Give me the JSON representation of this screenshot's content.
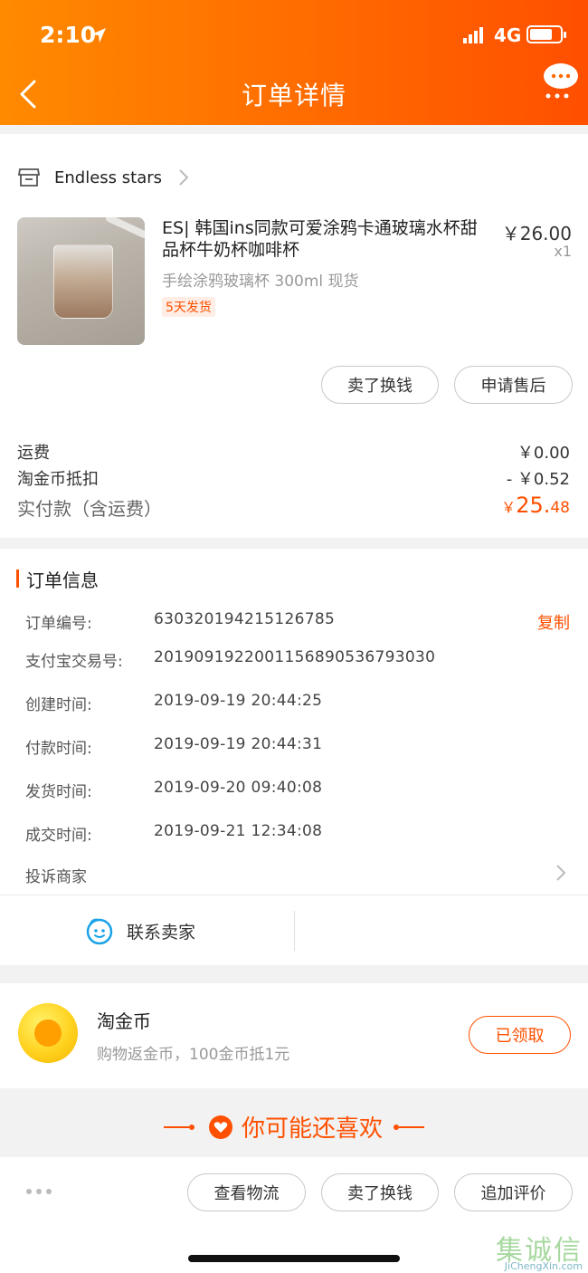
{
  "status_bar": {
    "time": "2:10",
    "network": "4G"
  },
  "header": {
    "title": "订单详情"
  },
  "store": {
    "name": "Endless stars"
  },
  "product": {
    "title": "ES| 韩国ins同款可爱涂鸦卡通玻璃水杯甜品杯牛奶杯咖啡杯",
    "price": "￥26.00",
    "quantity": "x1",
    "spec": "手绘涂鸦玻璃杯 300ml 现货",
    "ship_badge": "5天发货",
    "btn_sell": "卖了换钱",
    "btn_aftersale": "申请售后"
  },
  "fees": {
    "shipping_label": "运费",
    "shipping_value": "￥0.00",
    "coin_deduct_label": "淘金币抵扣",
    "coin_deduct_value": "- ￥0.52",
    "paid_label": "实付款（含运费）",
    "paid_currency": "￥",
    "paid_int": "25.",
    "paid_dec": "48"
  },
  "order_info": {
    "title": "订单信息",
    "copy": "复制",
    "rows": [
      {
        "label": "订单编号:",
        "value": "630320194215126785"
      },
      {
        "label": "支付宝交易号:",
        "value": "2019091922001156890536793030"
      },
      {
        "label": "创建时间:",
        "value": "2019-09-19 20:44:25"
      },
      {
        "label": "付款时间:",
        "value": "2019-09-19 20:44:31"
      },
      {
        "label": "发货时间:",
        "value": "2019-09-20 09:40:08"
      },
      {
        "label": "成交时间:",
        "value": "2019-09-21 12:34:08"
      }
    ],
    "complain": "投诉商家",
    "contact": "联系卖家"
  },
  "coin": {
    "title": "淘金币",
    "subtitle": "购物返金币，100金币抵1元",
    "button": "已领取"
  },
  "recommend": {
    "title": "你可能还喜欢"
  },
  "bottom_bar": {
    "btn_logistics": "查看物流",
    "btn_sell": "卖了换钱",
    "btn_review": "追加评价"
  },
  "watermark": {
    "zh": "集诚信",
    "en": "JiChengXin.com"
  },
  "colors": {
    "accent": "#ff5000",
    "header_start": "#ff8a00",
    "header_end": "#ff4f00"
  }
}
